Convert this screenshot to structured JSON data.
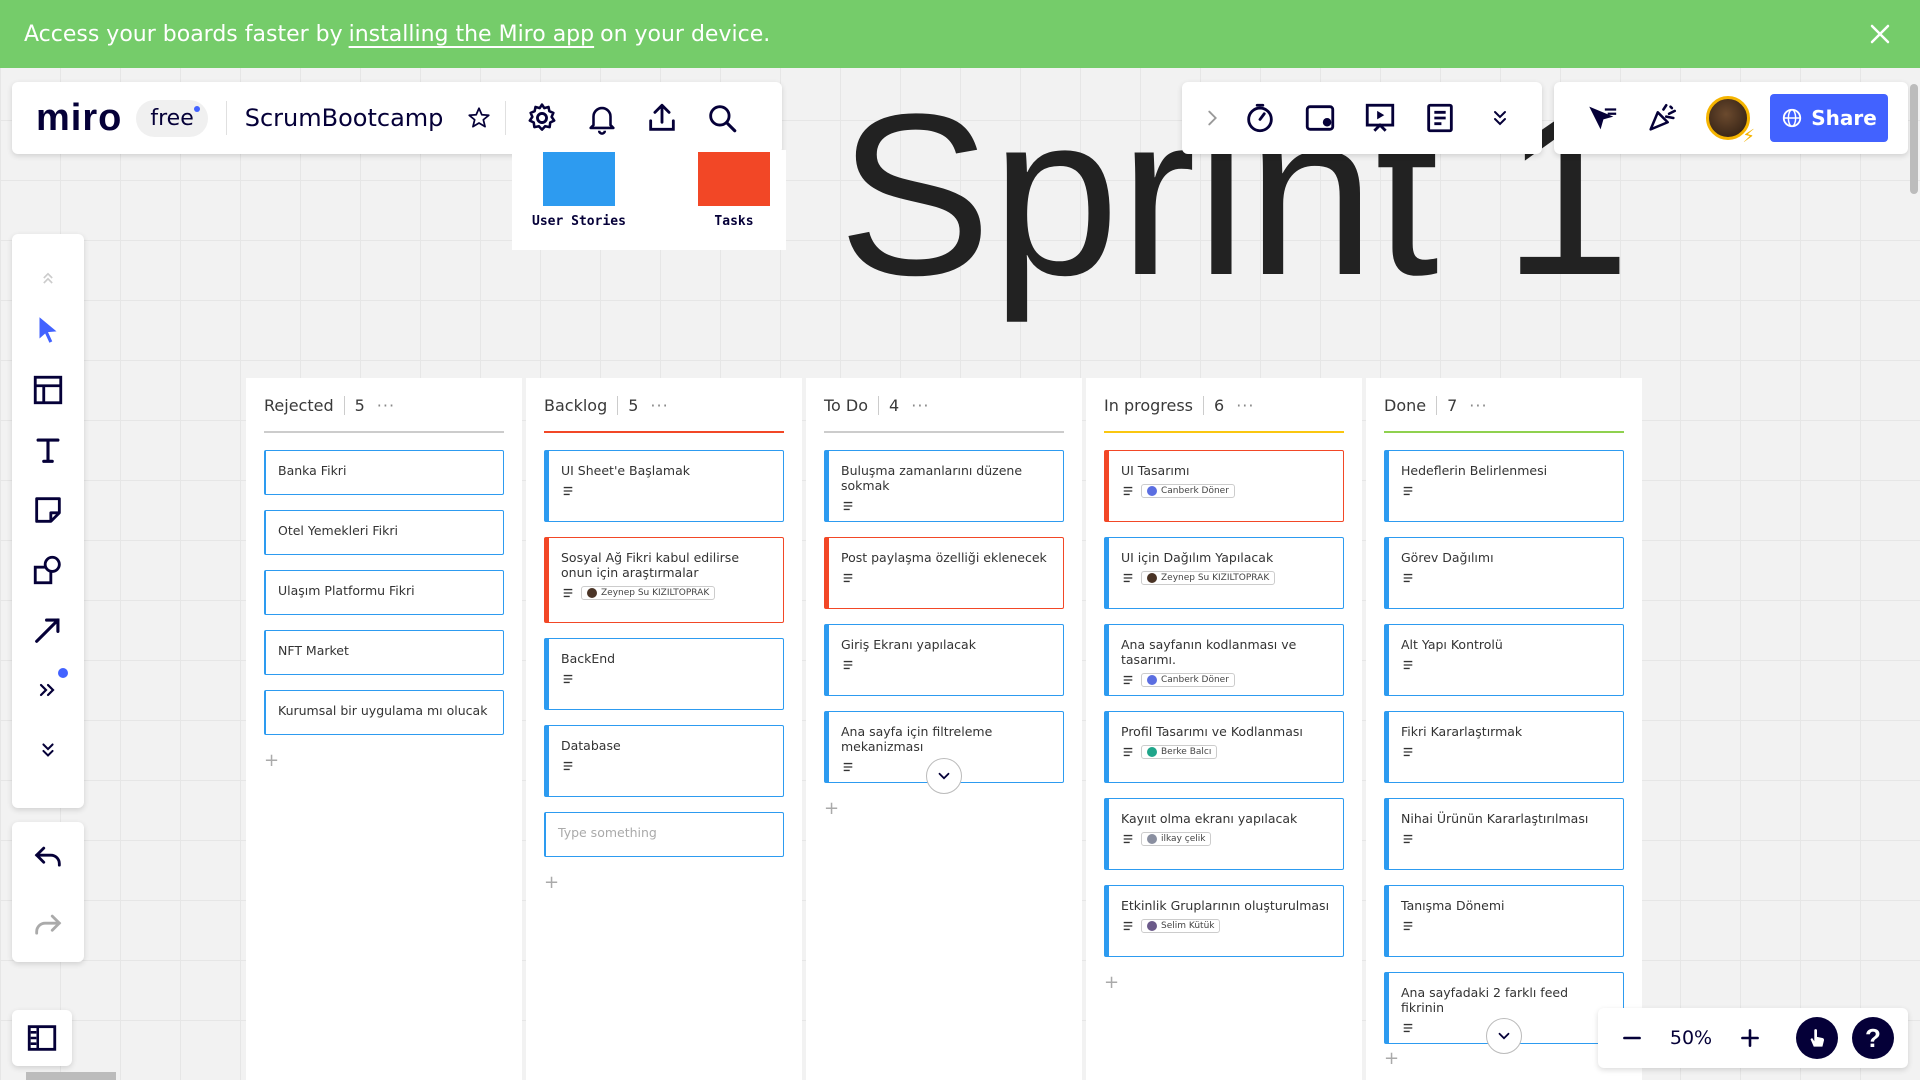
{
  "colors": {
    "banner_bg": "#75cc6a",
    "accent": "#4262ff",
    "user_story": "#2d9bf0",
    "task": "#f24726",
    "todo_line": "#cccccc",
    "inprogress_line": "#fac710",
    "done_line": "#8fd14f"
  },
  "banner": {
    "prefix": "Access your boards faster by",
    "link": "installing the Miro app",
    "suffix": "on your device.",
    "close_icon": "close-icon"
  },
  "header": {
    "logo": "miro",
    "plan": "free",
    "board_name": "ScrumBootcamp",
    "icons": [
      "star-icon",
      "gear-icon",
      "bell-icon",
      "upload-icon",
      "search-icon"
    ]
  },
  "tools_right": {
    "icons": [
      "chevron-right-icon",
      "timer-icon",
      "card-icon",
      "presentation-icon",
      "notes-icon",
      "chevron-double-down-icon"
    ]
  },
  "collab": {
    "icons": [
      "cursor-flag-icon",
      "celebrate-icon"
    ],
    "share_label": "Share"
  },
  "legend": {
    "items": [
      {
        "label": "User Stories",
        "color": "#2d9bf0"
      },
      {
        "label": "Tasks",
        "color": "#f24726"
      }
    ]
  },
  "sprint_title": "Sprint 1",
  "columns": [
    {
      "name": "Rejected",
      "count": "5",
      "line_color": "#cccccc",
      "cards": [
        {
          "title": "Banka Fikri",
          "type": "plain"
        },
        {
          "title": "Otel Yemekleri Fikri",
          "type": "plain"
        },
        {
          "title": "Ulaşım Platformu Fikri",
          "type": "plain"
        },
        {
          "title": "NFT Market",
          "type": "plain"
        },
        {
          "title": "Kurumsal bir uygulama mı olucak",
          "type": "plain"
        }
      ]
    },
    {
      "name": "Backlog",
      "count": "5",
      "line_color": "#f24726",
      "cards": [
        {
          "title": "UI Sheet'e Başlamak",
          "type": "blue"
        },
        {
          "title": "Sosyal Ağ Fikri kabul edilirse onun için araştırmalar",
          "type": "red",
          "assignee": "Zeynep Su KIZILTOPRAK"
        },
        {
          "title": "BackEnd",
          "type": "blue"
        },
        {
          "title": "Database",
          "type": "blue"
        },
        {
          "title": "Type something",
          "type": "placeholder"
        }
      ]
    },
    {
      "name": "To Do",
      "count": "4",
      "line_color": "#cccccc",
      "cards": [
        {
          "title": "Buluşma zamanlarını düzene sokmak",
          "type": "blue"
        },
        {
          "title": "Post paylaşma özelliği eklenecek",
          "type": "red"
        },
        {
          "title": "Giriş Ekranı yapılacak",
          "type": "blue"
        },
        {
          "title": "Ana sayfa için filtreleme mekanizması",
          "type": "blue"
        }
      ]
    },
    {
      "name": "In progress",
      "count": "6",
      "line_color": "#fac710",
      "cards": [
        {
          "title": "UI Tasarımı",
          "type": "red",
          "assignee": "Canberk Döner"
        },
        {
          "title": "UI için Dağılım Yapılacak",
          "type": "blue",
          "assignee": "Zeynep Su KIZILTOPRAK"
        },
        {
          "title": "Ana sayfanın kodlanması ve tasarımı.",
          "type": "blue",
          "assignee": "Canberk Döner"
        },
        {
          "title": "Profil Tasarımı ve Kodlanması",
          "type": "blue",
          "assignee": "Berke Balcı"
        },
        {
          "title": "Kayııt olma ekranı yapılacak",
          "type": "blue",
          "assignee": "ilkay çelik"
        },
        {
          "title": "Etkinlik Gruplarının oluşturulması",
          "type": "blue",
          "assignee": "Selim Kütük"
        }
      ]
    },
    {
      "name": "Done",
      "count": "7",
      "line_color": "#8fd14f",
      "cards": [
        {
          "title": "Hedeflerin Belirlenmesi",
          "type": "blue"
        },
        {
          "title": "Görev Dağılımı",
          "type": "blue"
        },
        {
          "title": "Alt Yapı Kontrolü",
          "type": "blue"
        },
        {
          "title": "Fikri Kararlaştırmak",
          "type": "blue"
        },
        {
          "title": "Nihai Ürünün Kararlaştırılması",
          "type": "blue"
        },
        {
          "title": "Tanışma Dönemi",
          "type": "blue"
        },
        {
          "title": "Ana sayfadaki 2 farklı feed fikrinin",
          "type": "blue"
        }
      ]
    }
  ],
  "zoom": {
    "value": "50%"
  }
}
